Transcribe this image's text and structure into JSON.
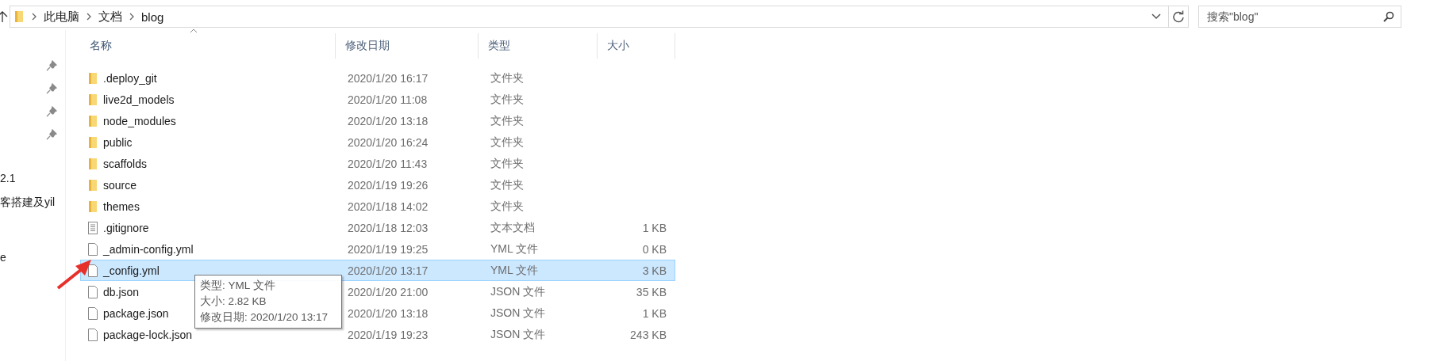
{
  "address_bar": {
    "breadcrumbs": [
      "此电脑",
      "文档",
      "blog"
    ]
  },
  "search": {
    "placeholder": "搜索\"blog\""
  },
  "nav_pane": {
    "items": [
      "2.1",
      "客搭建及yil",
      "e"
    ]
  },
  "columns": [
    {
      "label": "名称",
      "sorted": true
    },
    {
      "label": "修改日期",
      "sorted": false
    },
    {
      "label": "类型",
      "sorted": false
    },
    {
      "label": "大小",
      "sorted": false
    }
  ],
  "rows": [
    {
      "kind": "folder",
      "name": ".deploy_git",
      "date": "2020/1/20 16:17",
      "type": "文件夹",
      "selected": false
    },
    {
      "kind": "folder",
      "name": "live2d_models",
      "date": "2020/1/20 11:08",
      "type": "文件夹",
      "selected": false
    },
    {
      "kind": "folder",
      "name": "node_modules",
      "date": "2020/1/20 13:18",
      "type": "文件夹",
      "selected": false
    },
    {
      "kind": "folder",
      "name": "public",
      "date": "2020/1/20 16:24",
      "type": "文件夹",
      "selected": false
    },
    {
      "kind": "folder",
      "name": "scaffolds",
      "date": "2020/1/20 11:43",
      "type": "文件夹",
      "selected": false
    },
    {
      "kind": "folder",
      "name": "source",
      "date": "2020/1/19 19:26",
      "type": "文件夹",
      "selected": false
    },
    {
      "kind": "folder",
      "name": "themes",
      "date": "2020/1/18 14:02",
      "type": "文件夹",
      "selected": false
    },
    {
      "kind": "text",
      "name": ".gitignore",
      "date": "2020/1/18 12:03",
      "type": "文本文档",
      "size": "1 KB",
      "selected": false
    },
    {
      "kind": "file",
      "name": "_admin-config.yml",
      "date": "2020/1/19 19:25",
      "type": "YML 文件",
      "size": "0 KB",
      "selected": false
    },
    {
      "kind": "file",
      "name": "_config.yml",
      "date": "2020/1/20 13:17",
      "type": "YML 文件",
      "size": "3 KB",
      "selected": true
    },
    {
      "kind": "file",
      "name": "db.json",
      "date": "2020/1/20 21:00",
      "type": "JSON 文件",
      "size": "35 KB",
      "selected": false
    },
    {
      "kind": "file",
      "name": "package.json",
      "date": "2020/1/20 13:18",
      "type": "JSON 文件",
      "size": "1 KB",
      "selected": false
    },
    {
      "kind": "file",
      "name": "package-lock.json",
      "date": "2020/1/19 19:23",
      "type": "JSON 文件",
      "size": "243 KB",
      "selected": false
    }
  ],
  "tooltip": {
    "lines": [
      "类型: YML 文件",
      "大小: 2.82 KB",
      "修改日期: 2020/1/20 13:17"
    ]
  }
}
